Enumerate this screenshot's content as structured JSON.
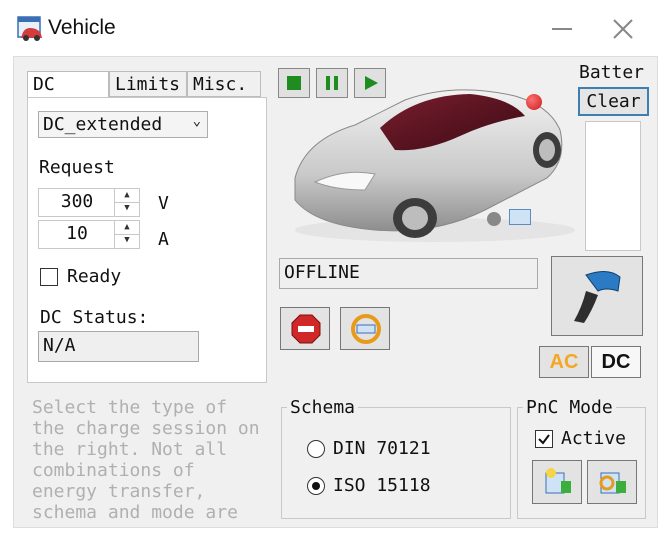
{
  "window": {
    "title": "Vehicle"
  },
  "tabs": [
    {
      "label": "DC",
      "active": true
    },
    {
      "label": "Limits",
      "active": false
    },
    {
      "label": "Misc.",
      "active": false
    }
  ],
  "dc": {
    "mode_select": "DC_extended",
    "request_label": "Request",
    "voltage": {
      "value": "300",
      "unit": "V"
    },
    "current": {
      "value": "10",
      "unit": "A"
    },
    "ready_label": "Ready",
    "ready_checked": false,
    "status_label": "DC Status:",
    "status_value": "N/A"
  },
  "sim_controls": {
    "stop": "stop-icon",
    "pause": "pause-icon",
    "play": "play-icon"
  },
  "connection_status": "OFFLINE",
  "battery": {
    "label": "Batter",
    "clear_label": "Clear"
  },
  "charge_type": {
    "ac_label": "AC",
    "dc_label": "DC"
  },
  "hint_text": "Select the type of\nthe charge session on\nthe right. Not all\ncombinations of\nenergy transfer,\nschema and mode are",
  "schema": {
    "title": "Schema",
    "options": [
      {
        "label": "DIN 70121",
        "selected": false
      },
      {
        "label": "ISO 15118",
        "selected": true
      }
    ]
  },
  "pnc": {
    "title": "PnC Mode",
    "active_label": "Active",
    "active_checked": true
  },
  "colors": {
    "accent_green": "#1e8c1e",
    "status_red": "#c81e1e",
    "ac_orange": "#f5a623",
    "focus_blue": "#3c7fb1"
  }
}
